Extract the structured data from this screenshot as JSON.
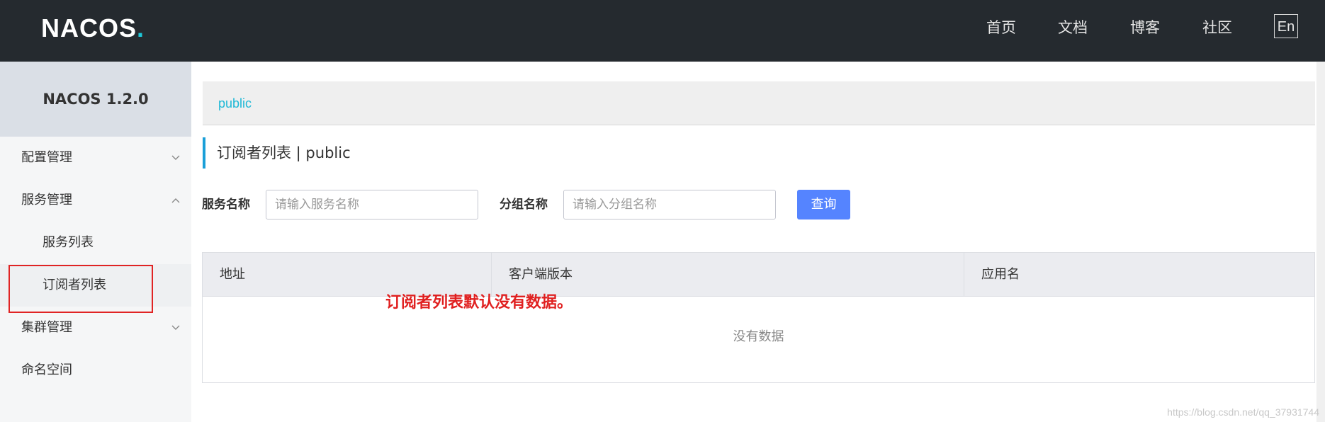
{
  "header": {
    "logo_text": "NACOS",
    "logo_dot": ".",
    "nav": [
      {
        "label": "首页"
      },
      {
        "label": "文档"
      },
      {
        "label": "博客"
      },
      {
        "label": "社区"
      }
    ],
    "lang_label": "En"
  },
  "sidebar": {
    "title": "NACOS 1.2.0",
    "items": [
      {
        "label": "配置管理",
        "icon": "chevron-down-icon"
      },
      {
        "label": "服务管理",
        "icon": "chevron-up-icon"
      },
      {
        "label": "服务列表"
      },
      {
        "label": "订阅者列表"
      },
      {
        "label": "集群管理",
        "icon": "chevron-down-icon"
      },
      {
        "label": "命名空间"
      }
    ]
  },
  "namespace": {
    "current": "public"
  },
  "page": {
    "title": "订阅者列表 | public"
  },
  "search": {
    "service_label": "服务名称",
    "service_placeholder": "请输入服务名称",
    "group_label": "分组名称",
    "group_placeholder": "请输入分组名称",
    "query_label": "查询"
  },
  "table": {
    "columns": [
      "地址",
      "客户端版本",
      "应用名"
    ],
    "empty_text": "没有数据"
  },
  "annotation": "订阅者列表默认没有数据。",
  "watermark": "https://blog.csdn.net/qq_37931744",
  "colors": {
    "header_bg": "#252a2f",
    "accent_cyan": "#1cb8d6",
    "primary_button": "#5584ff",
    "annotation_red": "#e02020"
  }
}
